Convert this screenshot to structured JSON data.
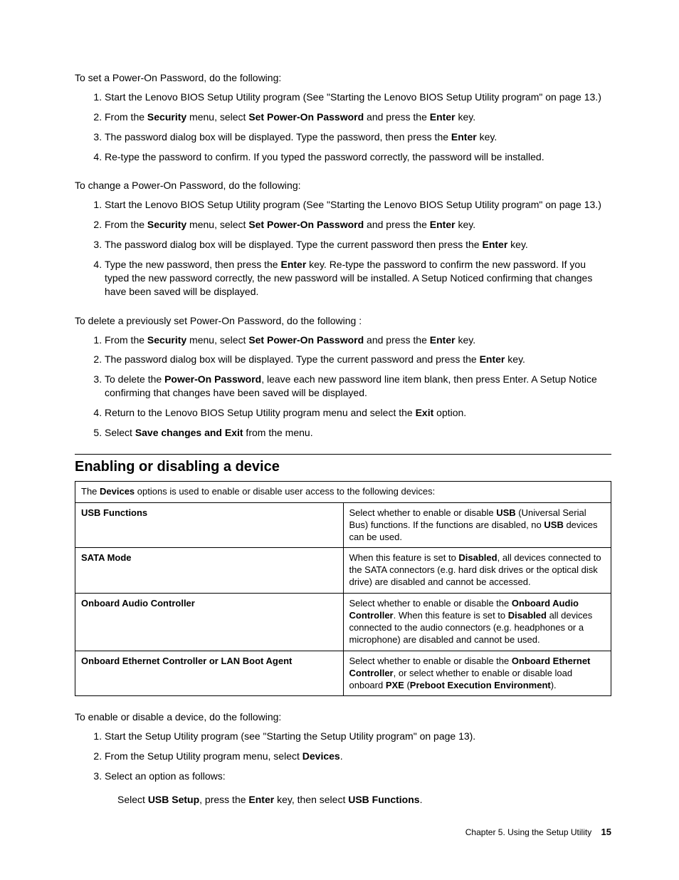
{
  "set": {
    "intro": "To set a Power-On Password, do the following:",
    "steps": [
      [
        {
          "t": "Start the Lenovo BIOS Setup Utility program (See \"Starting the Lenovo BIOS Setup Utility program\" on page 13.)"
        }
      ],
      [
        {
          "t": "From the "
        },
        {
          "t": "Security",
          "b": true
        },
        {
          "t": " menu, select "
        },
        {
          "t": "Set Power-On Password",
          "b": true
        },
        {
          "t": " and press the "
        },
        {
          "t": "Enter",
          "b": true
        },
        {
          "t": " key."
        }
      ],
      [
        {
          "t": "The password dialog box will be displayed. Type the password, then press the "
        },
        {
          "t": "Enter",
          "b": true
        },
        {
          "t": " key."
        }
      ],
      [
        {
          "t": "Re-type the password to confirm. If you typed the password correctly, the password will be installed."
        }
      ]
    ]
  },
  "change": {
    "intro": "To change a Power-On Password, do the following:",
    "steps": [
      [
        {
          "t": "Start the Lenovo BIOS Setup Utility program (See \"Starting the Lenovo BIOS Setup Utility program\" on page 13.)"
        }
      ],
      [
        {
          "t": "From the "
        },
        {
          "t": "Security",
          "b": true
        },
        {
          "t": " menu, select "
        },
        {
          "t": "Set Power-On Password",
          "b": true
        },
        {
          "t": " and press the "
        },
        {
          "t": "Enter",
          "b": true
        },
        {
          "t": " key."
        }
      ],
      [
        {
          "t": "The password dialog box will be displayed. Type the current password then press the "
        },
        {
          "t": "Enter",
          "b": true
        },
        {
          "t": " key."
        }
      ],
      [
        {
          "t": "Type the new password, then press the "
        },
        {
          "t": "Enter",
          "b": true
        },
        {
          "t": " key. Re-type the password to confirm the new password. If you typed the new password correctly, the new password will be installed. A Setup Noticed confirming that changes have been saved will be displayed."
        }
      ]
    ]
  },
  "del": {
    "intro": "To delete a previously set Power-On Password, do the following :",
    "steps": [
      [
        {
          "t": "From the "
        },
        {
          "t": "Security",
          "b": true
        },
        {
          "t": " menu, select "
        },
        {
          "t": "Set Power-On Password",
          "b": true
        },
        {
          "t": " and press the "
        },
        {
          "t": "Enter",
          "b": true
        },
        {
          "t": " key."
        }
      ],
      [
        {
          "t": "The password dialog box will be displayed. Type the current password and press the "
        },
        {
          "t": "Enter",
          "b": true
        },
        {
          "t": " key."
        }
      ],
      [
        {
          "t": "To delete the "
        },
        {
          "t": "Power-On Password",
          "b": true
        },
        {
          "t": ", leave each new password line item blank, then press Enter. A Setup Notice confirming that changes have been saved will be displayed."
        }
      ],
      [
        {
          "t": "Return to the Lenovo BIOS Setup Utility program menu and select the "
        },
        {
          "t": "Exit",
          "b": true
        },
        {
          "t": " option."
        }
      ],
      [
        {
          "t": "Select "
        },
        {
          "t": "Save changes and Exit",
          "b": true
        },
        {
          "t": " from the menu."
        }
      ]
    ]
  },
  "enable_section": {
    "title": "Enabling or disabling a device",
    "table_intro": [
      {
        "t": "The "
      },
      {
        "t": "Devices",
        "b": true
      },
      {
        "t": " options is used to enable or disable user access to the following devices:"
      }
    ],
    "rows": [
      {
        "left": "USB Functions",
        "right": [
          {
            "t": "Select whether to enable or disable "
          },
          {
            "t": "USB",
            "b": true
          },
          {
            "t": " (Universal Serial Bus) functions. If the functions are disabled, no "
          },
          {
            "t": "USB",
            "b": true
          },
          {
            "t": " devices can be used."
          }
        ]
      },
      {
        "left": "SATA Mode",
        "right": [
          {
            "t": "When this feature is set to "
          },
          {
            "t": "Disabled",
            "b": true
          },
          {
            "t": ", all devices connected to the SATA connectors (e.g. hard disk drives or the optical disk drive) are disabled and cannot be accessed."
          }
        ]
      },
      {
        "left": "Onboard Audio Controller",
        "right": [
          {
            "t": "Select whether to enable or disable the "
          },
          {
            "t": "Onboard Audio Controller",
            "b": true
          },
          {
            "t": ". When this feature is set to "
          },
          {
            "t": "Disabled",
            "b": true
          },
          {
            "t": " all devices connected to the audio connectors (e.g. headphones or a microphone) are disabled and cannot be used."
          }
        ]
      },
      {
        "left": "Onboard Ethernet Controller or LAN Boot Agent",
        "right": [
          {
            "t": "Select whether to enable or disable the "
          },
          {
            "t": "Onboard Ethernet Controller",
            "b": true
          },
          {
            "t": ", or select whether to enable or disable load onboard "
          },
          {
            "t": "PXE",
            "b": true
          },
          {
            "t": " ("
          },
          {
            "t": "Preboot Execution Environment",
            "b": true
          },
          {
            "t": ")."
          }
        ]
      }
    ],
    "post_intro": "To enable or disable a device, do the following:",
    "steps": [
      [
        {
          "t": "Start the Setup Utility program (see \"Starting the Setup Utility program\" on page 13)."
        }
      ],
      [
        {
          "t": "From the Setup Utility program menu, select "
        },
        {
          "t": "Devices",
          "b": true
        },
        {
          "t": "."
        }
      ],
      [
        {
          "t": "Select an option as follows:"
        }
      ]
    ],
    "sub": [
      {
        "t": "Select "
      },
      {
        "t": "USB Setup",
        "b": true
      },
      {
        "t": ", press the "
      },
      {
        "t": "Enter",
        "b": true
      },
      {
        "t": " key, then select "
      },
      {
        "t": "USB Functions",
        "b": true
      },
      {
        "t": "."
      }
    ]
  },
  "footer": {
    "chapter": "Chapter 5. Using the Setup Utility",
    "page": "15"
  }
}
